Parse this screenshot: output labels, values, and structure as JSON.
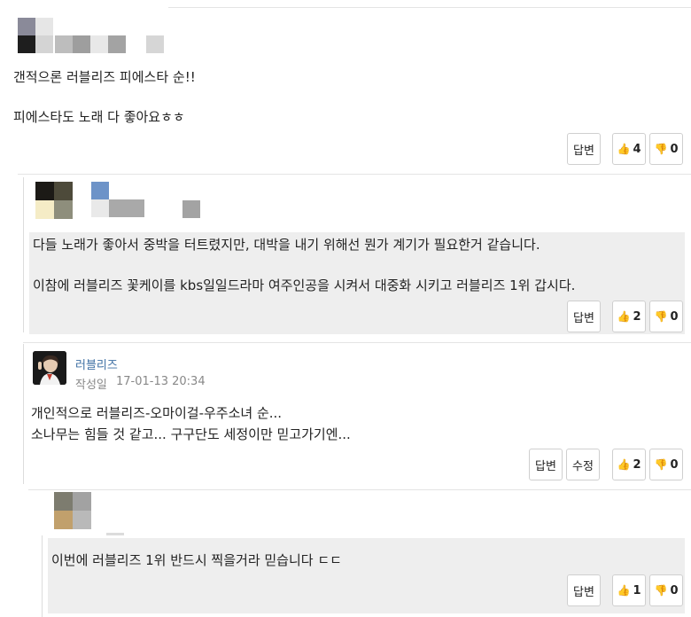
{
  "comments": [
    {
      "lines": [
        "갠적으론 러블리즈 피에스타 순!!",
        "피에스타도 노래 다 좋아요ㅎㅎ"
      ],
      "reply_label": "답변",
      "likes": "4",
      "dislikes": "0"
    },
    {
      "lines": [
        "다들 노래가 좋아서 중박을 터트렸지만, 대박을 내기 위해선 뭔가 계기가 필요한거 같습니다.",
        "이참에 러블리즈 꽃케이를 kbs일일드라마 여주인공을 시켜서 대중화 시키고 러블리즈 1위 갑시다."
      ],
      "reply_label": "답변",
      "likes": "2",
      "dislikes": "0"
    },
    {
      "author": "러블리즈",
      "meta_label": "작성일",
      "date": "17-01-13 20:34",
      "lines": [
        "개인적으로 러블리즈-오마이걸-우주소녀 순...",
        "소나무는 힘들 것 같고... 구구단도 세정이만 믿고가기엔..."
      ],
      "reply_label": "답변",
      "edit_label": "수정",
      "likes": "2",
      "dislikes": "0"
    },
    {
      "lines": [
        "이번에 러블리즈 1위 반드시 찍을거라 믿습니다 ㄷㄷ"
      ],
      "reply_label": "답변",
      "likes": "1",
      "dislikes": "0"
    }
  ],
  "icons": {
    "like": "thumbs-up-icon",
    "dislike": "thumbs-down-icon"
  },
  "colors": {
    "username": "#3e6fa3",
    "reply_background": "#eeeeee"
  }
}
